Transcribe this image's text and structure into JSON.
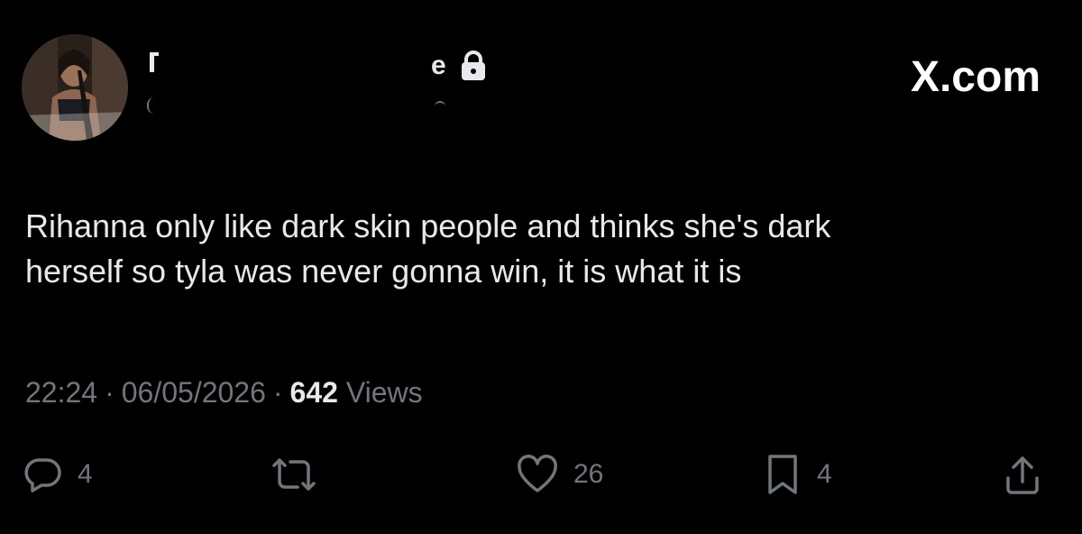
{
  "header": {
    "name_fragment_right": "e",
    "brand": "X.com"
  },
  "tweet": {
    "text": "Rihanna only like dark skin people and thinks she's dark\nherself so tyla was never gonna win, it is what it is"
  },
  "meta": {
    "time": "22:24",
    "separator": "·",
    "date": "06/05/2026",
    "views_count": "642",
    "views_label": "Views"
  },
  "actions": {
    "reply_count": "4",
    "retweet_count": "",
    "like_count": "26",
    "bookmark_count": "4"
  },
  "colors": {
    "background": "#000000",
    "text_primary": "#e7e9ea",
    "text_secondary": "#71767b"
  },
  "icons": {
    "reply": "speech-bubble-icon",
    "retweet": "retweet-arrows-icon",
    "like": "heart-icon",
    "bookmark": "bookmark-icon",
    "share": "share-upload-icon",
    "lock": "lock-icon"
  }
}
